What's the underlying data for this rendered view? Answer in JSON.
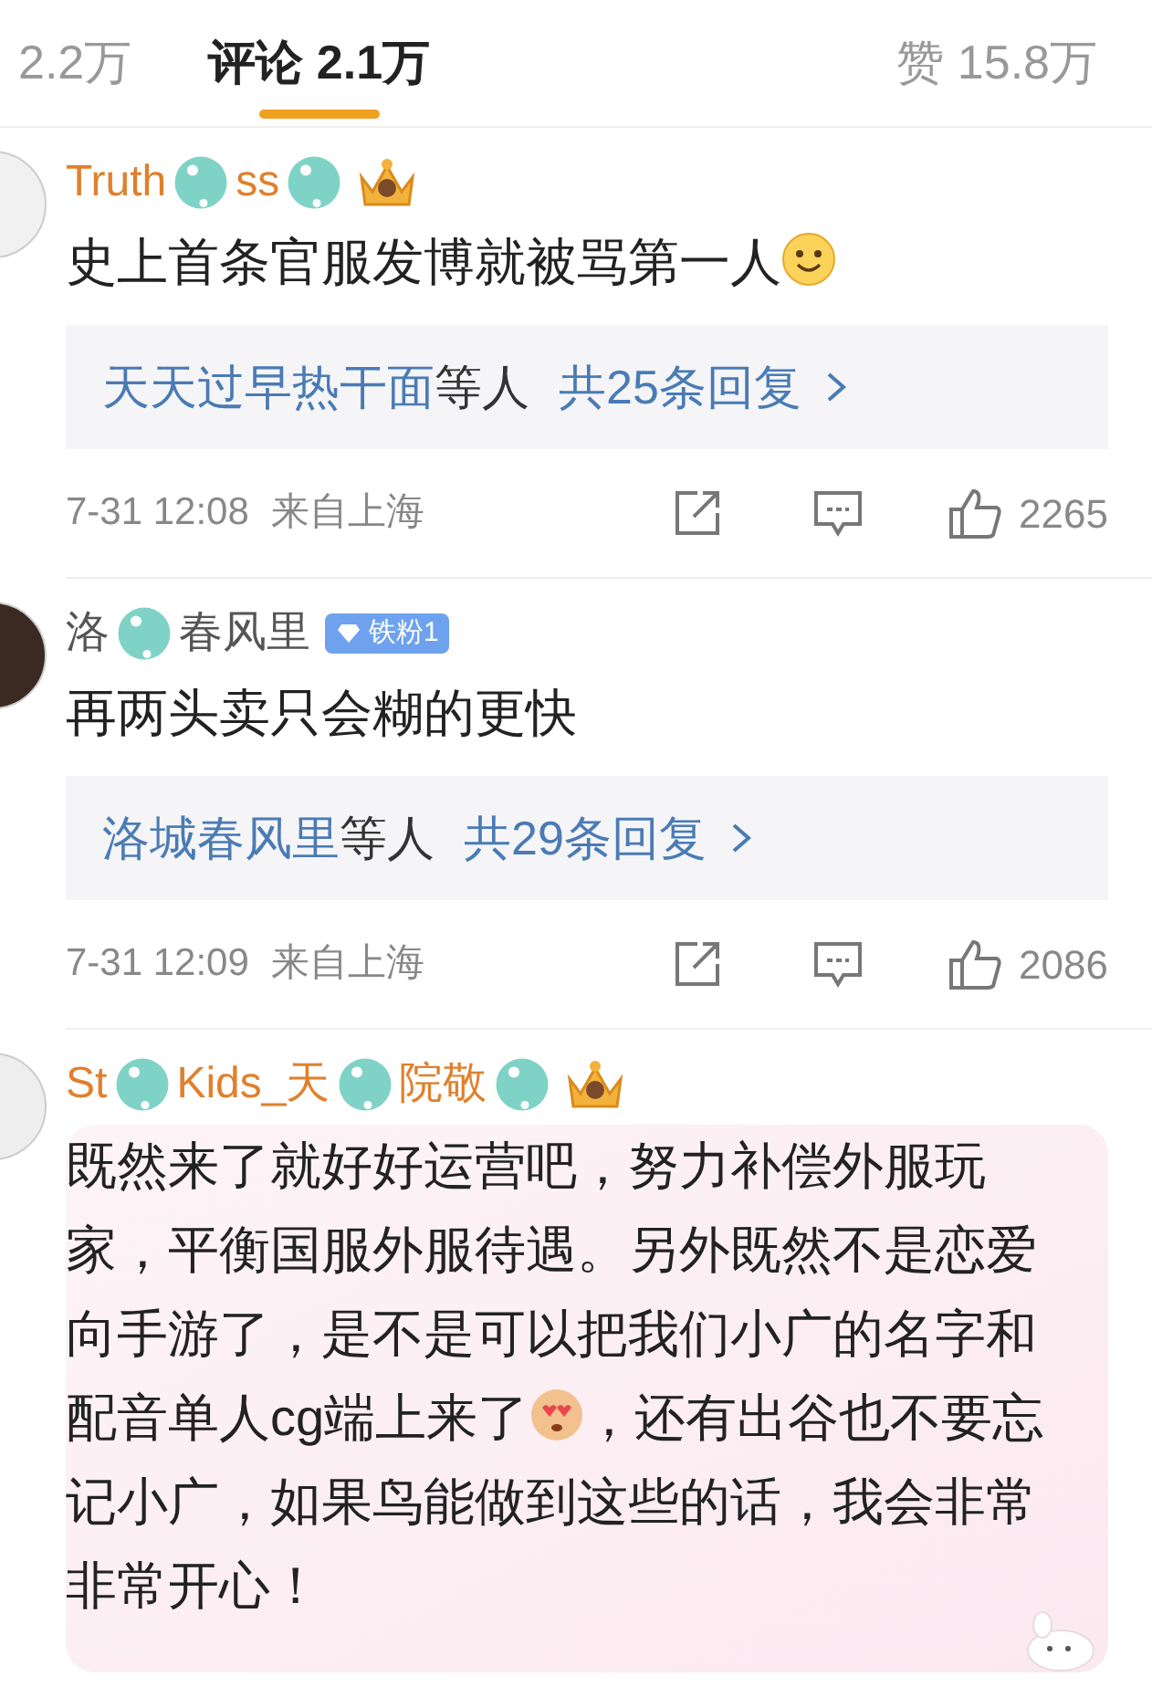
{
  "tabs": [
    {
      "label": "2.2万",
      "selected": false
    },
    {
      "label": "评论 2.1万",
      "selected": true
    },
    {
      "label": "赞 15.8万",
      "selected": false
    }
  ],
  "comments": [
    {
      "vip": true,
      "bubble": false,
      "name_parts": [
        {
          "kind": "text",
          "text": "Truth"
        },
        {
          "kind": "blot"
        },
        {
          "kind": "text",
          "text": "ss"
        },
        {
          "kind": "blot"
        }
      ],
      "badge": {
        "kind": "crown"
      },
      "body": [
        {
          "kind": "text",
          "text": "史上首条官服发博就被骂第一人"
        },
        {
          "kind": "smile"
        }
      ],
      "replies": {
        "names": "天天过早热干面",
        "others": "等人",
        "count": "共25条回复"
      },
      "time": "7-31 12:08",
      "location": "来自上海",
      "likes": "2265"
    },
    {
      "vip": false,
      "bubble": false,
      "name_parts": [
        {
          "kind": "text",
          "text": "洛"
        },
        {
          "kind": "blot"
        },
        {
          "kind": "text",
          "text": "春风里"
        }
      ],
      "badge": {
        "kind": "fan",
        "text": "铁粉1"
      },
      "body": [
        {
          "kind": "text",
          "text": "再两头卖只会糊的更快"
        }
      ],
      "replies": {
        "names": "洛城春风里",
        "others": "等人",
        "count": "共29条回复"
      },
      "time": "7-31 12:09",
      "location": "来自上海",
      "likes": "2086"
    },
    {
      "vip": true,
      "bubble": true,
      "name_parts": [
        {
          "kind": "text",
          "text": "St"
        },
        {
          "kind": "blot"
        },
        {
          "kind": "text",
          "text": "Kids_天"
        },
        {
          "kind": "blot"
        },
        {
          "kind": "text",
          "text": "院敬"
        },
        {
          "kind": "blot"
        }
      ],
      "badge": {
        "kind": "crown"
      },
      "body": [
        {
          "kind": "text",
          "text": "既然来了就好好运营吧，努力补偿外服玩家，平衡国服外服待遇。另外既然不是恋爱向手游了，是不是可以把我们小广的名字和配音单人cg端上来了"
        },
        {
          "kind": "heart-eyes"
        },
        {
          "kind": "text",
          "text": "，还有出谷也不要忘记小广，如果鸟能做到这些的话，我会非常非常开心！"
        }
      ]
    }
  ]
}
